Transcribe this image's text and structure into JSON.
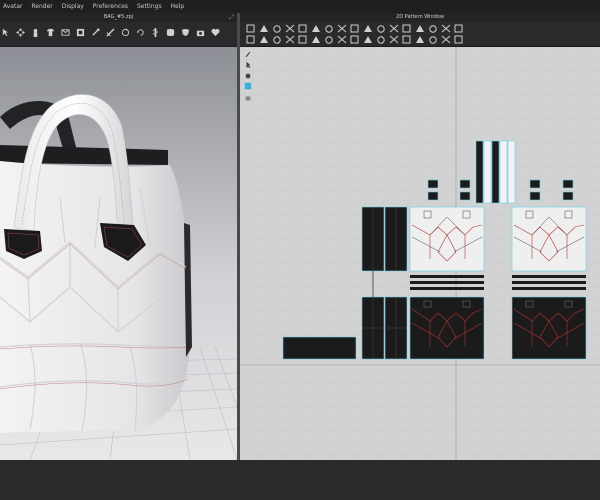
{
  "menu": [
    "Avatar",
    "Render",
    "Display",
    "Preferences",
    "Settings",
    "Help"
  ],
  "window_3d": {
    "title": "BAG_#5.zpj"
  },
  "window_2d": {
    "title": "2D Pattern Window"
  },
  "icons": {
    "toolbar_3d": [
      "select-icon",
      "move-icon",
      "avatar-icon",
      "garment-icon",
      "fold-icon",
      "sew-icon",
      "pin-icon",
      "measure-icon",
      "sync-icon",
      "rotate-icon",
      "zipper-icon",
      "fabric-icon",
      "shield-icon",
      "camera-icon",
      "heart-icon"
    ],
    "toolbar_2d_row1": [
      "move-icon",
      "polygon-icon",
      "rectangle-icon",
      "circle-icon",
      "spline-icon",
      "edit-point-icon",
      "curve-icon",
      "point-icon",
      "internal-line-icon",
      "scissor-icon",
      "seam-icon",
      "fold-icon",
      "dart-icon",
      "text-icon",
      "annotation-icon",
      "pin-icon",
      "ruler-icon"
    ],
    "toolbar_2d_row2": [
      "select-icon",
      "lock-icon",
      "gather-icon",
      "tape-icon",
      "curve-edit-icon",
      "offset-icon",
      "trace-icon",
      "sewing-icon",
      "segment-sew-icon",
      "free-sew-icon",
      "check-icon",
      "layout-icon",
      "text-icon",
      "fit-icon",
      "grading-icon",
      "zoom-icon",
      "symmetric-icon"
    ],
    "side_2d": [
      "brush-icon",
      "pointer-icon",
      "mic-icon",
      "layers-icon",
      "hand-icon"
    ]
  },
  "colors": {
    "fabric_white": "#efefef",
    "fabric_black": "#1b1b1b",
    "selection_cyan": "#6fd0ea",
    "stitch_red": "#c03030",
    "workspace_bg": "#d2d2d2"
  }
}
